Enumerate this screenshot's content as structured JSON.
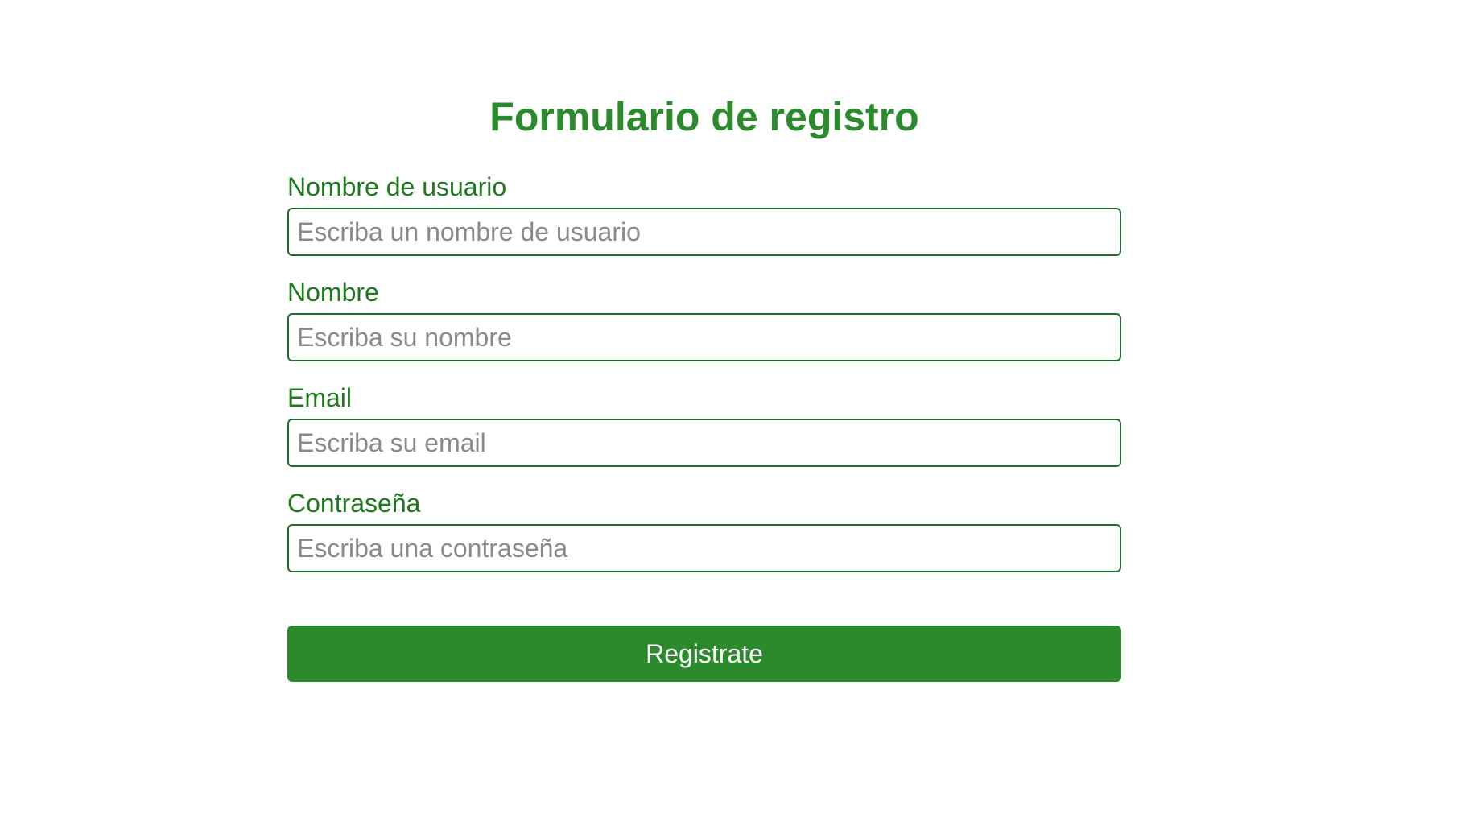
{
  "form": {
    "title": "Formulario de registro",
    "fields": [
      {
        "label": "Nombre de usuario",
        "placeholder": "Escriba un nombre de usuario",
        "value": ""
      },
      {
        "label": "Nombre",
        "placeholder": "Escriba su nombre",
        "value": ""
      },
      {
        "label": "Email",
        "placeholder": "Escriba su email",
        "value": ""
      },
      {
        "label": "Contraseña",
        "placeholder": "Escriba una contraseña",
        "value": ""
      }
    ],
    "submit_label": "Registrate"
  },
  "colors": {
    "accent": "#2b8a2b",
    "label": "#1f7a1f",
    "input_border": "#1f6f2a",
    "placeholder": "#8a8a8a",
    "background": "#ffffff"
  }
}
